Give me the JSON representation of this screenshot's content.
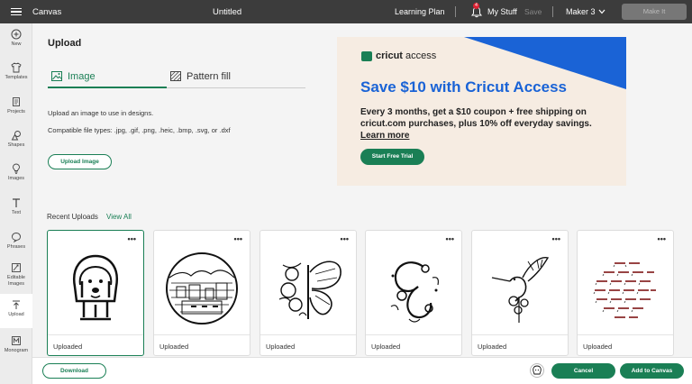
{
  "topbar": {
    "app_title": "Canvas",
    "doc_title": "Untitled",
    "learning_plan": "Learning Plan",
    "notification_count": "4",
    "my_stuff": "My Stuff",
    "save": "Save",
    "machine": "Maker 3",
    "make_it": "Make It"
  },
  "sidebar": {
    "items": [
      {
        "label": "New",
        "icon": "plus-icon"
      },
      {
        "label": "Templates",
        "icon": "shirt-icon"
      },
      {
        "label": "Projects",
        "icon": "projects-icon"
      },
      {
        "label": "Shapes",
        "icon": "shapes-icon"
      },
      {
        "label": "Images",
        "icon": "lightbulb-icon"
      },
      {
        "label": "Text",
        "icon": "text-icon"
      },
      {
        "label": "Phrases",
        "icon": "speech-bubble-icon"
      },
      {
        "label": "Editable Images",
        "icon": "editable-images-icon"
      },
      {
        "label": "Upload",
        "icon": "upload-icon"
      },
      {
        "label": "Monogram",
        "icon": "monogram-icon"
      }
    ]
  },
  "panel": {
    "title": "Upload",
    "tabs": [
      {
        "label": "Image",
        "active": true
      },
      {
        "label": "Pattern fill",
        "active": false
      }
    ],
    "description": "Upload an image to use in designs.",
    "compatible": "Compatible file types: .jpg, .gif, .png, .heic, .bmp, .svg, or .dxf",
    "upload_button": "Upload Image"
  },
  "ad": {
    "logo_brand": "cricut",
    "logo_suffix": "access",
    "headline": "Save $10 with Cricut Access",
    "body": "Every 3 months, get a $10 coupon + free shipping on cricut.com purchases, plus 10% off everyday savings.",
    "learn_more": "Learn more",
    "cta": "Start Free Trial",
    "colors": {
      "blue": "#1a63d6",
      "green": "#1a7f55",
      "background": "#f6ece2"
    }
  },
  "recent": {
    "label": "Recent Uploads",
    "view_all": "View All",
    "cards": [
      {
        "caption": "Uploaded",
        "image": "hooded-dog-drawing",
        "selected": true
      },
      {
        "caption": "Uploaded",
        "image": "circular-town-scene",
        "selected": false
      },
      {
        "caption": "Uploaded",
        "image": "floral-butterfly",
        "selected": false
      },
      {
        "caption": "Uploaded",
        "image": "floral-letter-c",
        "selected": false
      },
      {
        "caption": "Uploaded",
        "image": "hummingbird-flowers",
        "selected": false
      },
      {
        "caption": "Uploaded",
        "image": "dog-pattern-circle",
        "selected": false
      }
    ],
    "more_icon": "•••"
  },
  "bottom": {
    "download": "Download",
    "cancel": "Cancel",
    "add_to_canvas": "Add to Canvas"
  },
  "accent_color": "#1a7f55"
}
